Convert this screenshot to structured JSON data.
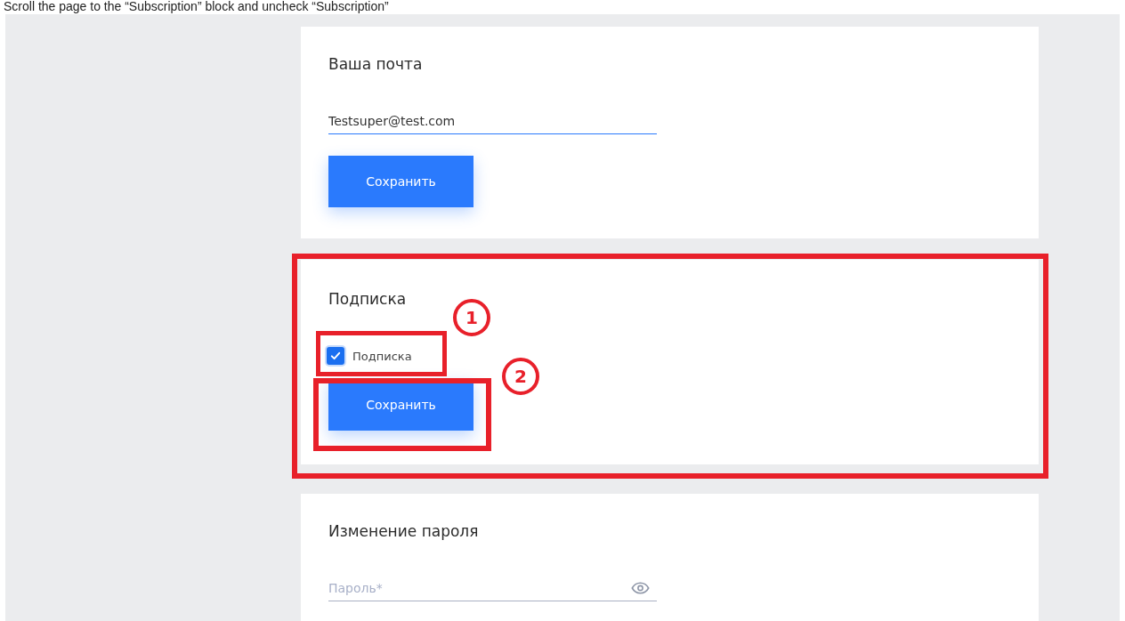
{
  "instruction": "Scroll the page to the “Subscription” block and uncheck “Subscription”",
  "sections": [
    {
      "kind": "email",
      "title": "Ваша почта",
      "field": {
        "value": "Testsuper@test.com"
      },
      "button": "Сохранить",
      "highlighted": false
    },
    {
      "kind": "subscription",
      "title": "Подписка",
      "checkbox": {
        "label": "Подписка",
        "checked": true
      },
      "button": "Сохранить",
      "highlighted": true
    },
    {
      "kind": "password",
      "title": "Изменение пароля",
      "field": {
        "placeholder": "Пароль*"
      },
      "highlighted": false
    }
  ],
  "callouts": [
    "1",
    "2"
  ]
}
